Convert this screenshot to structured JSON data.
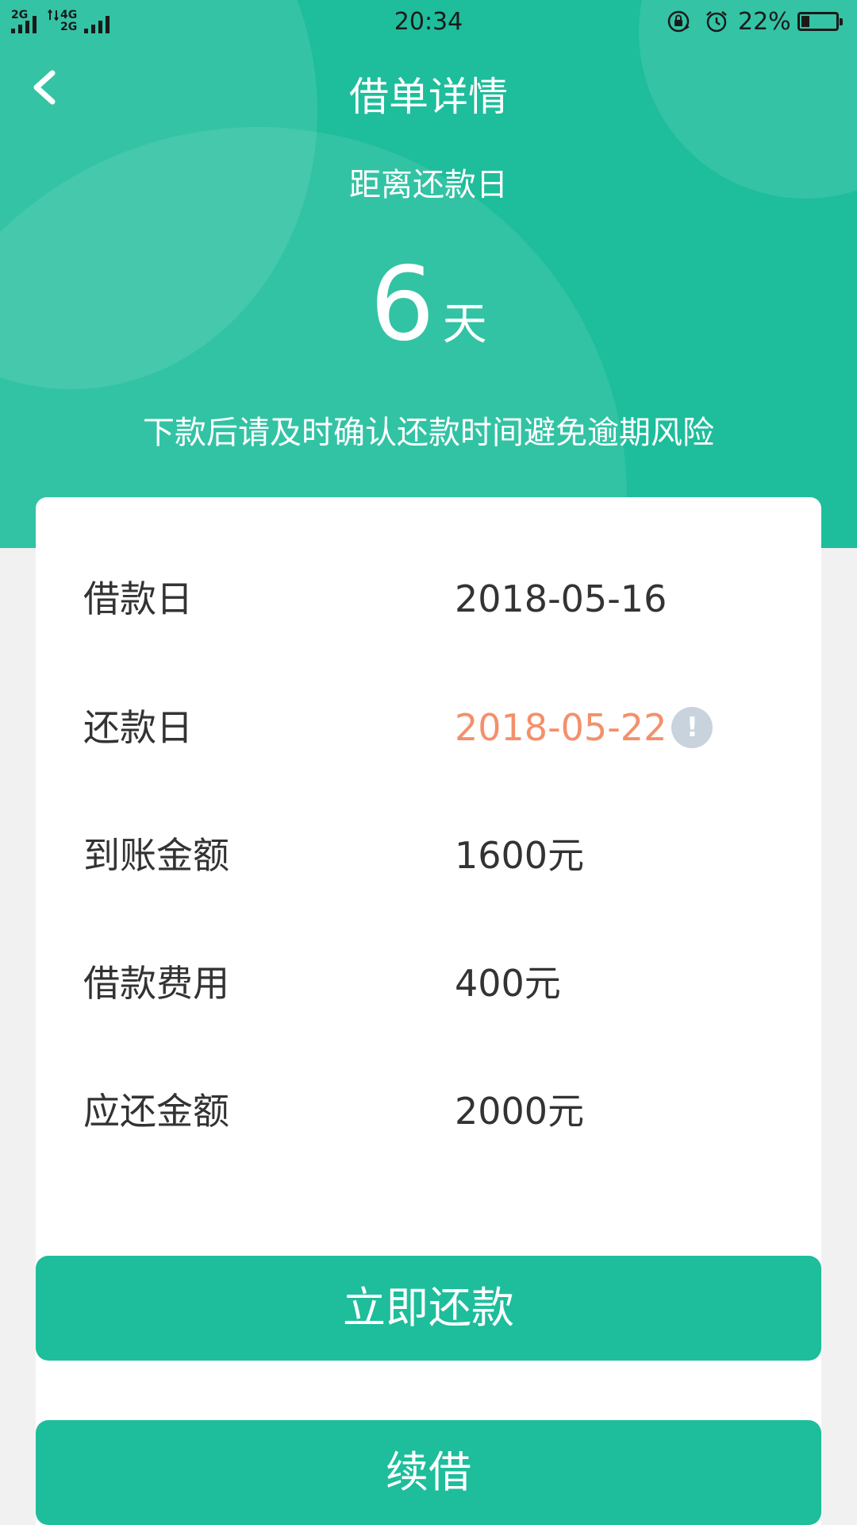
{
  "status_bar": {
    "sim1_label": "2G",
    "sim2_label_top": "4G",
    "sim2_label_bottom": "2G",
    "time": "20:34",
    "battery_percent_text": "22%",
    "battery_level": 0.22,
    "icons": [
      "signal-icon",
      "lock-rotate-icon",
      "alarm-icon",
      "battery-icon"
    ]
  },
  "header": {
    "back_icon": "chevron-left-icon",
    "title": "借单详情"
  },
  "countdown": {
    "label": "距离还款日",
    "days": "6",
    "unit": "天",
    "notice": "下款后请及时确认还款时间避免逾期风险"
  },
  "details": [
    {
      "label": "借款日",
      "value": "2018-05-16"
    },
    {
      "label": "还款日",
      "value": "2018-05-22"
    },
    {
      "label": "到账金额",
      "value": "1600元"
    },
    {
      "label": "借款费用",
      "value": "400元"
    },
    {
      "label": "应还金额",
      "value": "2000元"
    }
  ],
  "due_info_icon": "!",
  "actions": {
    "repay_label": "立即还款",
    "renew_label": "续借"
  },
  "colors": {
    "primary": "#1ebd9b",
    "due_date": "#f3906b",
    "info_icon": "#c8d3dd",
    "text": "#333333",
    "background": "#f1f1f1"
  }
}
